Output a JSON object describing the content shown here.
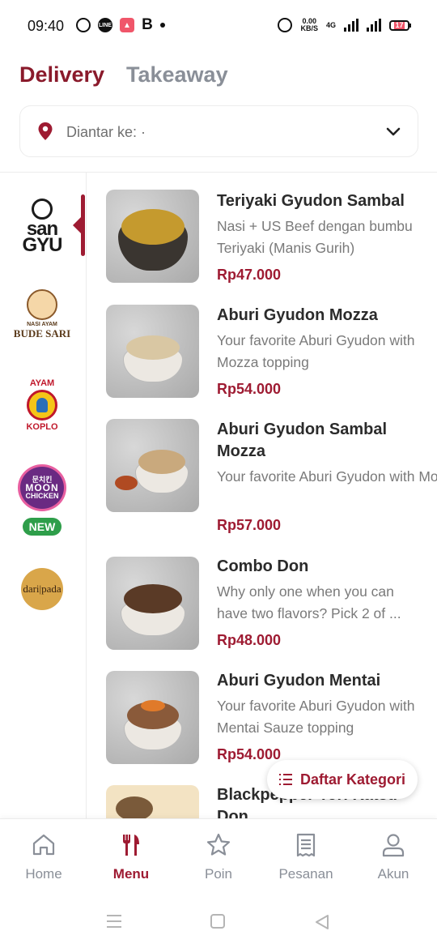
{
  "status_bar": {
    "time": "09:40",
    "notif_b": "B",
    "speed_value": "0.00",
    "speed_unit": "KB/S",
    "network": "4G",
    "battery": "17"
  },
  "mode_tabs": {
    "active": "Delivery",
    "inactive": "Takeaway"
  },
  "address": {
    "label": "Diantar ke: ·"
  },
  "brands": [
    {
      "name": "sangyu",
      "logo_text": "san GYU",
      "active": true
    },
    {
      "name": "nasi-ayam-bude-sari",
      "small": "NASI AYAM",
      "big": "BUDE SARI"
    },
    {
      "name": "ayam-koplo",
      "top": "AYAM",
      "bottom": "KOPLO"
    },
    {
      "name": "moon-chicken",
      "top": "문치킨",
      "main": "MOON",
      "sub": "CHICKEN",
      "badge": "NEW"
    },
    {
      "name": "daripada",
      "logo_text": "dari|pada"
    }
  ],
  "menu_items": [
    {
      "name": "Teriyaki Gyudon Sambal",
      "description": "Nasi + US Beef dengan bumbu Teriyaki (Manis Gurih)",
      "price": "Rp47.000"
    },
    {
      "name": "Aburi Gyudon Mozza",
      "description": "Your favorite Aburi Gyudon with Mozza topping",
      "price": "Rp54.000"
    },
    {
      "name": "Aburi Gyudon Sambal Mozza",
      "description": "Your favorite Aburi Gyudon with Mozza and Sambal top...",
      "price": "Rp57.000"
    },
    {
      "name": "Combo Don",
      "description": "Why only one when you can have two flavors? Pick 2 of ...",
      "price": "Rp48.000"
    },
    {
      "name": "Aburi Gyudon Mentai",
      "description": "Your favorite Aburi Gyudon with Mentai Sauze topping",
      "price": "Rp54.000"
    },
    {
      "name": "Blackpepper Tori Katsu Don",
      "description": "",
      "price": ""
    }
  ],
  "category_button": {
    "label": "Daftar Kategori"
  },
  "bottom_nav": [
    {
      "label": "Home",
      "icon": "home-icon"
    },
    {
      "label": "Menu",
      "icon": "fork-knife-icon",
      "active": true
    },
    {
      "label": "Poin",
      "icon": "star-icon"
    },
    {
      "label": "Pesanan",
      "icon": "receipt-icon"
    },
    {
      "label": "Akun",
      "icon": "user-icon"
    }
  ],
  "colors": {
    "brand": "#9e1b32",
    "inactive": "#8a8f98",
    "new_badge": "#2e9e4a"
  }
}
